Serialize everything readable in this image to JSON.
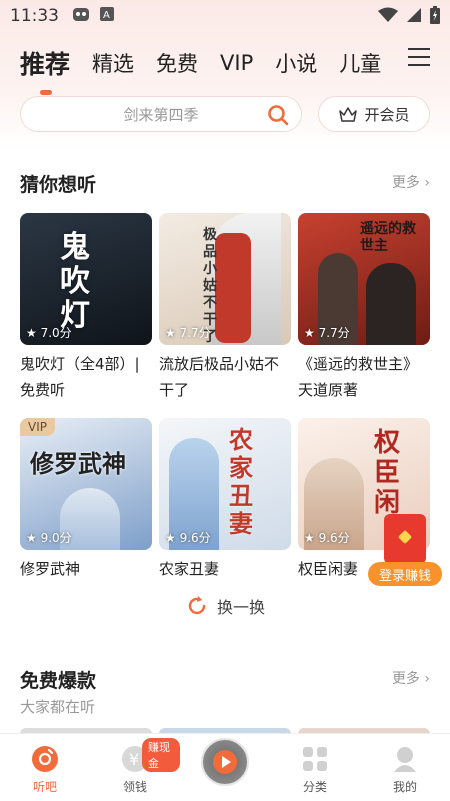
{
  "status_bar": {
    "time": "11:33",
    "notif_icon_letter": "A"
  },
  "tabs": [
    {
      "label": "推荐",
      "active": true
    },
    {
      "label": "精选"
    },
    {
      "label": "免费"
    },
    {
      "label": "VIP"
    },
    {
      "label": "小说"
    },
    {
      "label": "儿童"
    }
  ],
  "search": {
    "placeholder": "剑来第四季"
  },
  "vip_button": {
    "label": "开会员"
  },
  "section_guess": {
    "title": "猜你想听",
    "more": "更多",
    "books": [
      {
        "title": "鬼吹灯（全4部）|免费听",
        "rating": "7.0分",
        "cover_text": "鬼吹灯",
        "cover_bg": "#1d2630"
      },
      {
        "title": "流放后极品小姑不干了",
        "rating": "7.7分",
        "cover_text": "极品小姑不干了",
        "cover_bg": "#e9ddd0"
      },
      {
        "title": "《遥远的救世主》天道原著",
        "rating": "7.7分",
        "cover_text": "遥远的救世主",
        "cover_bg": "#b8372d"
      },
      {
        "title": "修罗武神",
        "rating": "9.0分",
        "cover_text": "修罗武神",
        "cover_bg": "#8fb0d6",
        "vip": "VIP"
      },
      {
        "title": "农家丑妻",
        "rating": "9.6分",
        "cover_text": "农家丑妻",
        "cover_bg": "#dfe7f0"
      },
      {
        "title": "权臣闲妻",
        "rating": "9.6分",
        "cover_text": "权臣闲",
        "cover_bg": "#f1e2d6"
      }
    ]
  },
  "refresh_label": "换一换",
  "login_earn": "登录赚钱",
  "section_free": {
    "title": "免费爆款",
    "subtitle": "大家都在听",
    "more": "更多"
  },
  "bottom_nav": [
    {
      "label": "听吧",
      "active": true
    },
    {
      "label": "领钱",
      "badge": "赚现金"
    },
    {
      "label": ""
    },
    {
      "label": "分类"
    },
    {
      "label": "我的"
    }
  ],
  "colors": {
    "accent": "#f26b3a",
    "earn": "#f7922c",
    "redpack": "#e8392f"
  }
}
